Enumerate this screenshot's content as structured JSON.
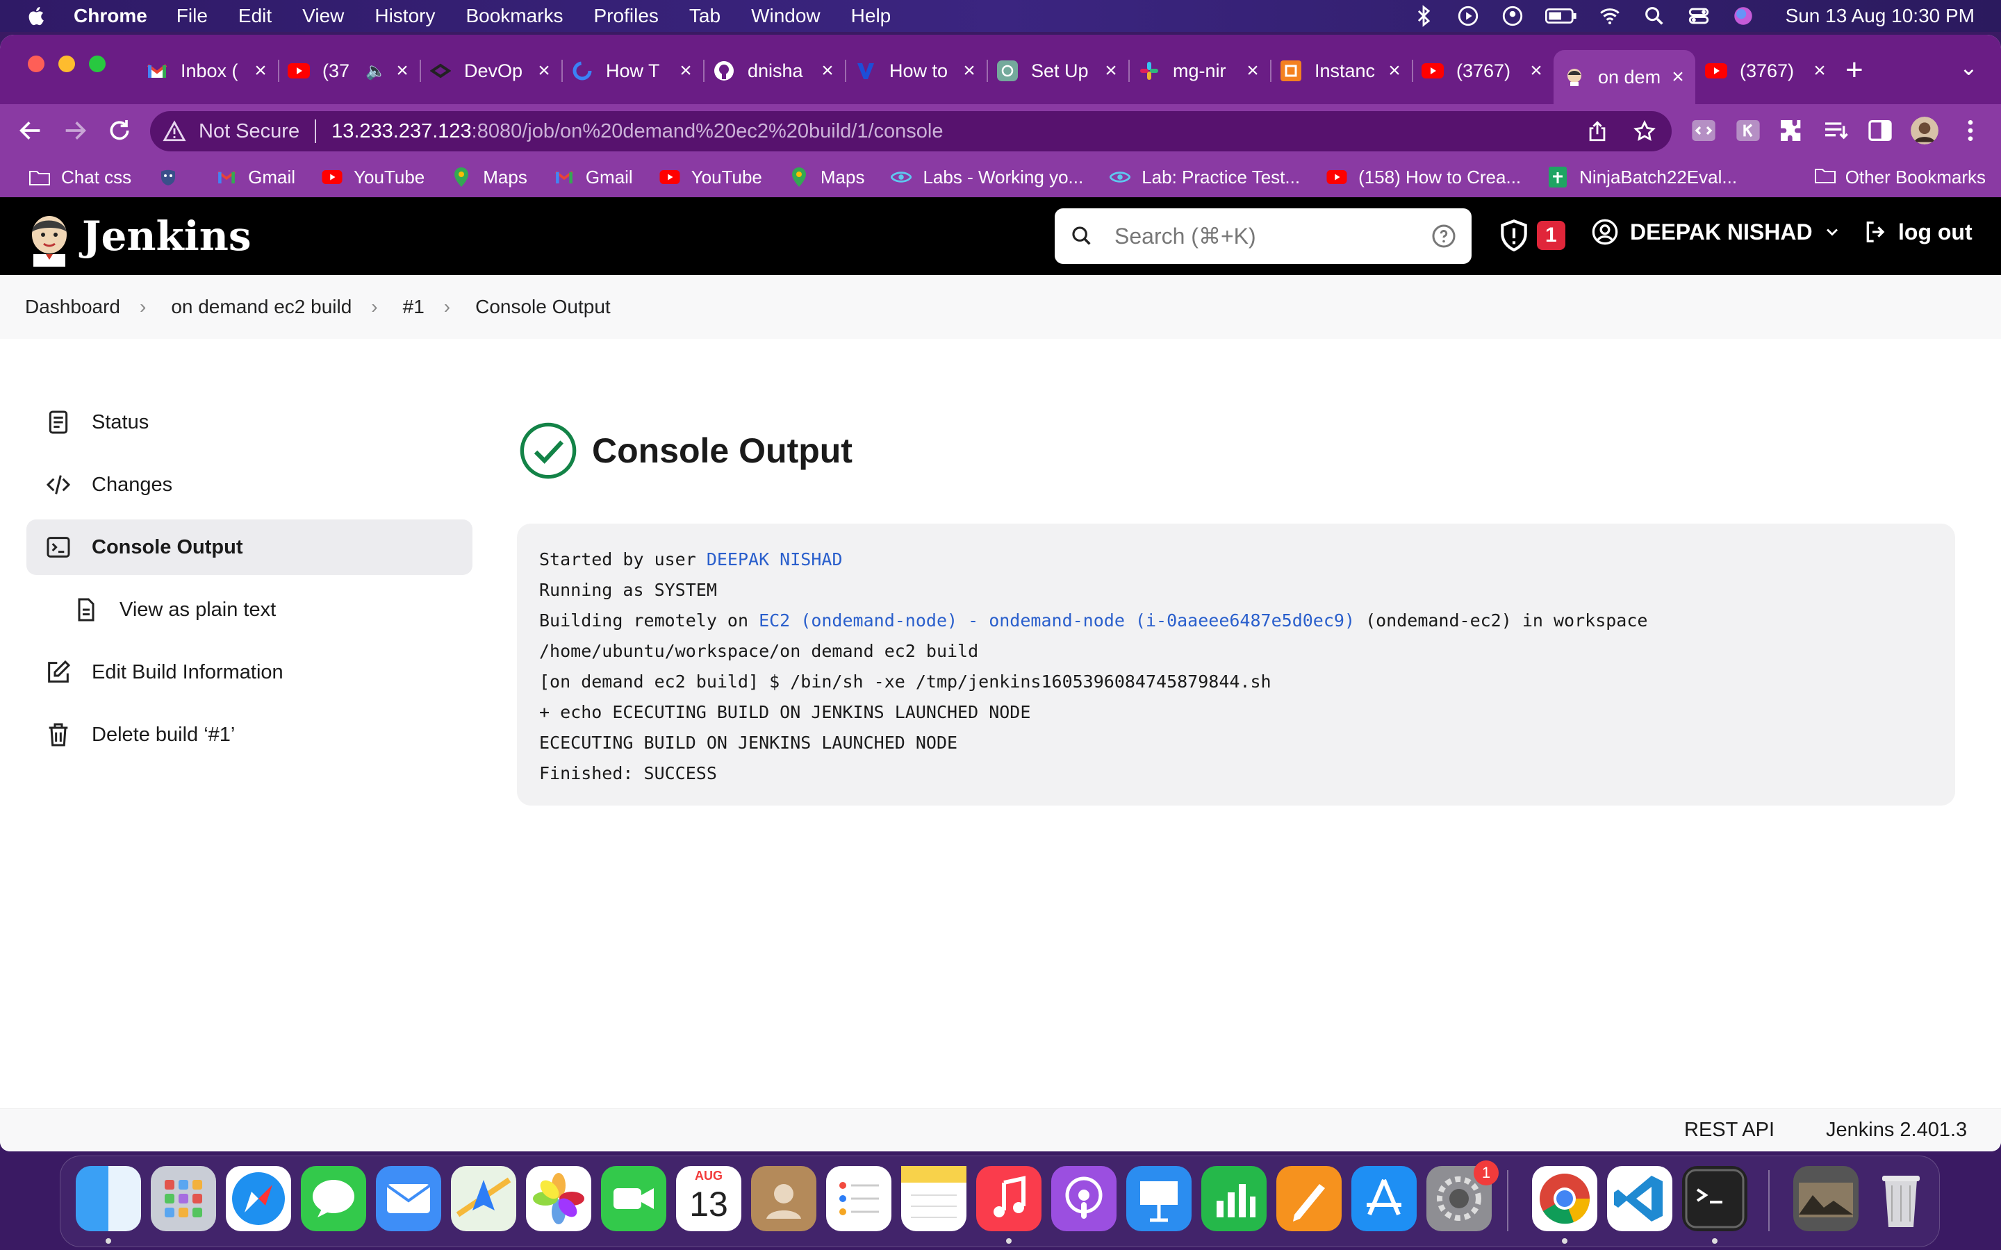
{
  "menubar": {
    "app_name": "Chrome",
    "items": [
      "File",
      "Edit",
      "View",
      "History",
      "Bookmarks",
      "Profiles",
      "Tab",
      "Window",
      "Help"
    ],
    "clock": "Sun 13 Aug  10:30 PM"
  },
  "tabs": [
    {
      "label": "Inbox (",
      "icon": "gmail-icon"
    },
    {
      "label": "(37",
      "icon": "youtube-icon"
    },
    {
      "label": "DevOp",
      "icon": "devops-icon"
    },
    {
      "label": "How T",
      "icon": "loader-icon"
    },
    {
      "label": "dnisha",
      "icon": "github-icon"
    },
    {
      "label": "How to",
      "icon": "v-icon"
    },
    {
      "label": "Set Up",
      "icon": "chatgpt-icon"
    },
    {
      "label": "mg-nir",
      "icon": "slack-icon"
    },
    {
      "label": "Instanc",
      "icon": "aws-icon"
    },
    {
      "label": "(3767)",
      "icon": "youtube-icon"
    },
    {
      "label": "on dem",
      "icon": "jenkins-icon",
      "active": true
    },
    {
      "label": "(3767)",
      "icon": "youtube-icon"
    }
  ],
  "omnibox": {
    "security": "Not Secure",
    "host": "13.233.237.123",
    "path": ":8080/job/on%20demand%20ec2%20build/1/console"
  },
  "bookmarks": [
    {
      "label": "Chat css",
      "icon": "folder-icon"
    },
    {
      "label": "",
      "icon": "mask-icon"
    },
    {
      "label": "Gmail",
      "icon": "gmail-icon"
    },
    {
      "label": "YouTube",
      "icon": "youtube-icon"
    },
    {
      "label": "Maps",
      "icon": "maps-icon"
    },
    {
      "label": "Gmail",
      "icon": "gmail-icon"
    },
    {
      "label": "YouTube",
      "icon": "youtube-icon"
    },
    {
      "label": "Maps",
      "icon": "maps-icon"
    },
    {
      "label": "Labs - Working yo...",
      "icon": "eye-icon"
    },
    {
      "label": "Lab: Practice Test...",
      "icon": "eye-icon"
    },
    {
      "label": "(158) How to Crea...",
      "icon": "youtube-icon"
    },
    {
      "label": "NinjaBatch22Eval...",
      "icon": "sheets-icon"
    }
  ],
  "other_bookmarks": "Other Bookmarks",
  "jenkins": {
    "title": "Jenkins",
    "search_placeholder": "Search (⌘+K)",
    "security_count": "1",
    "user": "DEEPAK NISHAD",
    "logout": "log out"
  },
  "breadcrumbs": [
    "Dashboard",
    "on demand ec2 build",
    "#1",
    "Console Output"
  ],
  "sidebar": [
    {
      "label": "Status",
      "icon": "document-icon"
    },
    {
      "label": "Changes",
      "icon": "code-icon"
    },
    {
      "label": "Console Output",
      "icon": "terminal-icon",
      "active": true
    },
    {
      "label": "View as plain text",
      "icon": "file-icon",
      "sub": true
    },
    {
      "label": "Edit Build Information",
      "icon": "edit-icon"
    },
    {
      "label": "Delete build ‘#1’",
      "icon": "trash-icon"
    }
  ],
  "page_title": "Console Output",
  "console": {
    "line1_prefix": "Started by user ",
    "line1_link": "DEEPAK NISHAD",
    "line2": "Running as SYSTEM",
    "line3_prefix": "Building remotely on ",
    "line3_link": "EC2 (ondemand-node) - ondemand-node (i-0aaeee6487e5d0ec9)",
    "line3_suffix": " (ondemand-ec2) in workspace",
    "line4": "/home/ubuntu/workspace/on demand ec2 build",
    "line5": "[on demand ec2 build] $ /bin/sh -xe /tmp/jenkins1605396084745879844.sh",
    "line6": "+ echo ECECUTING BUILD ON JENKINS LAUNCHED NODE",
    "line7": "ECECUTING BUILD ON JENKINS LAUNCHED NODE",
    "line8": "Finished: SUCCESS"
  },
  "footer": {
    "rest_api": "REST API",
    "version": "Jenkins 2.401.3"
  },
  "dock": {
    "calendar_month": "AUG",
    "calendar_day": "13",
    "settings_badge": "1"
  }
}
